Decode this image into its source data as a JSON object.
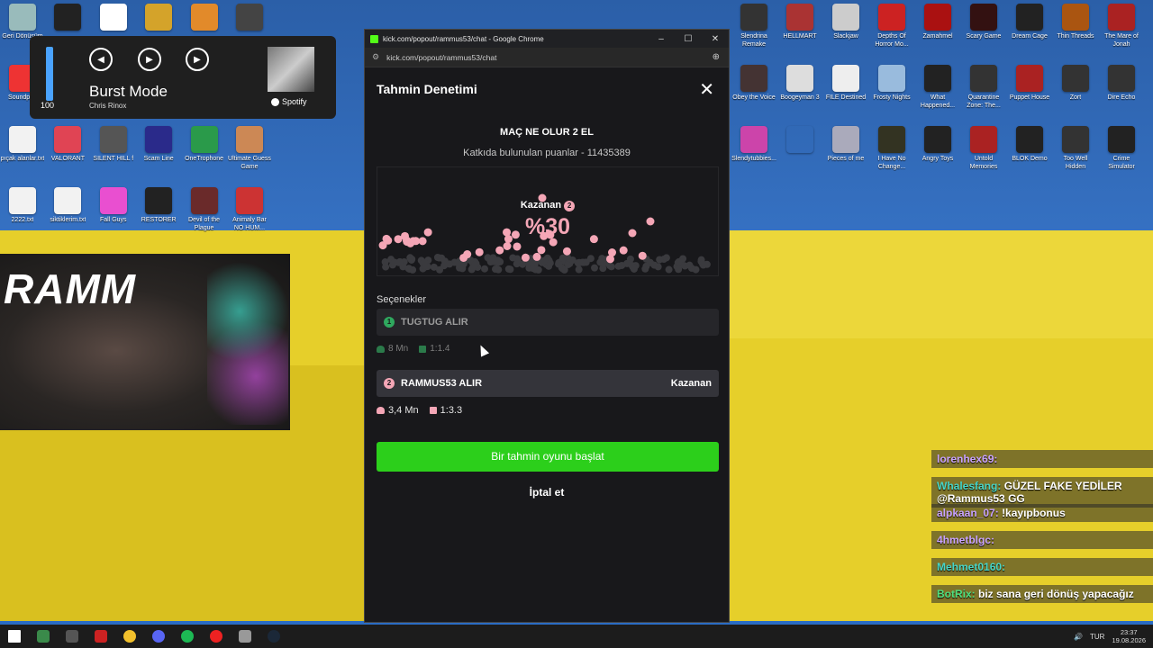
{
  "media": {
    "volume": "100",
    "volume_fraction": 1.0,
    "track": "Burst Mode",
    "artist": "Chris Rinox",
    "service": "Spotify"
  },
  "browser": {
    "title": "kick.com/popout/rammus53/chat - Google Chrome",
    "url": "kick.com/popout/rammus53/chat"
  },
  "prediction": {
    "panel_title": "Tahmin Denetimi",
    "question": "MAÇ NE OLUR 2 EL",
    "points_text": "Katkıda bulunulan puanlar - 11435389",
    "winner_label": "Kazanan",
    "winner_num": "2",
    "winner_pct": "%30",
    "options_title": "Seçenekler",
    "option1": {
      "num": "1",
      "label": "TUGTUG ALIR",
      "points": "8 Mn",
      "ratio": "1:1.4"
    },
    "option2": {
      "num": "2",
      "label": "RAMMUS53 ALIR",
      "winner_tag": "Kazanan",
      "points": "3,4 Mn",
      "ratio": "1:3.3"
    },
    "start_button": "Bir tahmin oyunu başlat",
    "cancel_button": "İptal et",
    "colors": {
      "win": "#f4a6b6",
      "lose": "#2fa85e",
      "start": "#2ccf1b"
    }
  },
  "webcam_logo": "RAMM",
  "chat": [
    {
      "user": "lorenhex69:",
      "text": "",
      "style": "purple"
    },
    {
      "user": "Whalesfang:",
      "text": "GÜZEL FAKE YEDİLER @Rammus53 GG",
      "style": "teal"
    },
    {
      "user": "alpkaan_07:",
      "text": "!kayıpbonus",
      "style": "purple"
    },
    {
      "user": "4hmetblgc:",
      "text": "",
      "style": "purple"
    },
    {
      "user": "Mehmet0160:",
      "text": "",
      "style": "teal"
    },
    {
      "user": "BotRix:",
      "text": "biz sana geri dönüş yapacağız",
      "style": "green"
    }
  ],
  "desktop_left": [
    {
      "label": "Geri Dönüşüm",
      "color": "#9bb"
    },
    {
      "label": "",
      "color": "#222"
    },
    {
      "label": "",
      "color": "#fff"
    },
    {
      "label": "",
      "color": "#d4a32a"
    },
    {
      "label": "",
      "color": "#e28a2a"
    },
    {
      "label": "",
      "color": "#444"
    },
    {
      "label": "Soundpad",
      "color": "#e33"
    },
    {
      "label": "",
      "color": "#333"
    },
    {
      "label": "",
      "color": "#333"
    },
    {
      "label": "",
      "color": "#333"
    },
    {
      "label": "",
      "color": "#333"
    },
    {
      "label": "",
      "color": "#333"
    },
    {
      "label": "pıçak alanlar.txt",
      "color": "#f2f2f2"
    },
    {
      "label": "VALORANT",
      "color": "#e04454"
    },
    {
      "label": "SILENT HILL f",
      "color": "#555"
    },
    {
      "label": "Scam Line",
      "color": "#2a2a8a"
    },
    {
      "label": "OneTrophone",
      "color": "#2a9a4a"
    },
    {
      "label": "Ultimate Guess Game",
      "color": "#c85"
    },
    {
      "label": "2222.txt",
      "color": "#f2f2f2"
    },
    {
      "label": "siktiklerim.txt",
      "color": "#f2f2f2"
    },
    {
      "label": "Fall Guys",
      "color": "#e94fd0"
    },
    {
      "label": "RESTORER",
      "color": "#222"
    },
    {
      "label": "Devil of the Plague",
      "color": "#6a2a2a"
    },
    {
      "label": "Animaly Bar NO HUM...",
      "color": "#c33"
    }
  ],
  "desktop_right": [
    {
      "label": "Slendrina Remake",
      "color": "#333"
    },
    {
      "label": "HELLMART",
      "color": "#a33"
    },
    {
      "label": "Slackjaw",
      "color": "#ccc"
    },
    {
      "label": "Depths Of Horror Mo...",
      "color": "#c22"
    },
    {
      "label": "Zamahmel",
      "color": "#a11"
    },
    {
      "label": "Scary Game",
      "color": "#311"
    },
    {
      "label": "Dream Cage",
      "color": "#222"
    },
    {
      "label": "Thin Threads",
      "color": "#a51"
    },
    {
      "label": "The Mare of Jonah",
      "color": "#a22"
    },
    {
      "label": "Obey the Voice",
      "color": "#433"
    },
    {
      "label": "Boogeyman 3",
      "color": "#ddd"
    },
    {
      "label": "FILE Destined",
      "color": "#eee"
    },
    {
      "label": "Frosty Nights",
      "color": "#9bd"
    },
    {
      "label": "What Happened...",
      "color": "#222"
    },
    {
      "label": "Quarantine Zone: The...",
      "color": "#333"
    },
    {
      "label": "Puppet House",
      "color": "#a22"
    },
    {
      "label": "Zort",
      "color": "#333"
    },
    {
      "label": "Dire Echo",
      "color": "#333"
    },
    {
      "label": "Slendytubbies...",
      "color": "#c4a"
    },
    {
      "label": "",
      "color": "transparent"
    },
    {
      "label": "Pieces of me",
      "color": "#aab"
    },
    {
      "label": "I Have No Change...",
      "color": "#332"
    },
    {
      "label": "Angry Toys",
      "color": "#222"
    },
    {
      "label": "Untold Memories",
      "color": "#a22"
    },
    {
      "label": "BLOK Demo",
      "color": "#222"
    },
    {
      "label": "Too Well Hidden",
      "color": "#333"
    },
    {
      "label": "Crime Simulator",
      "color": "#222"
    }
  ]
}
